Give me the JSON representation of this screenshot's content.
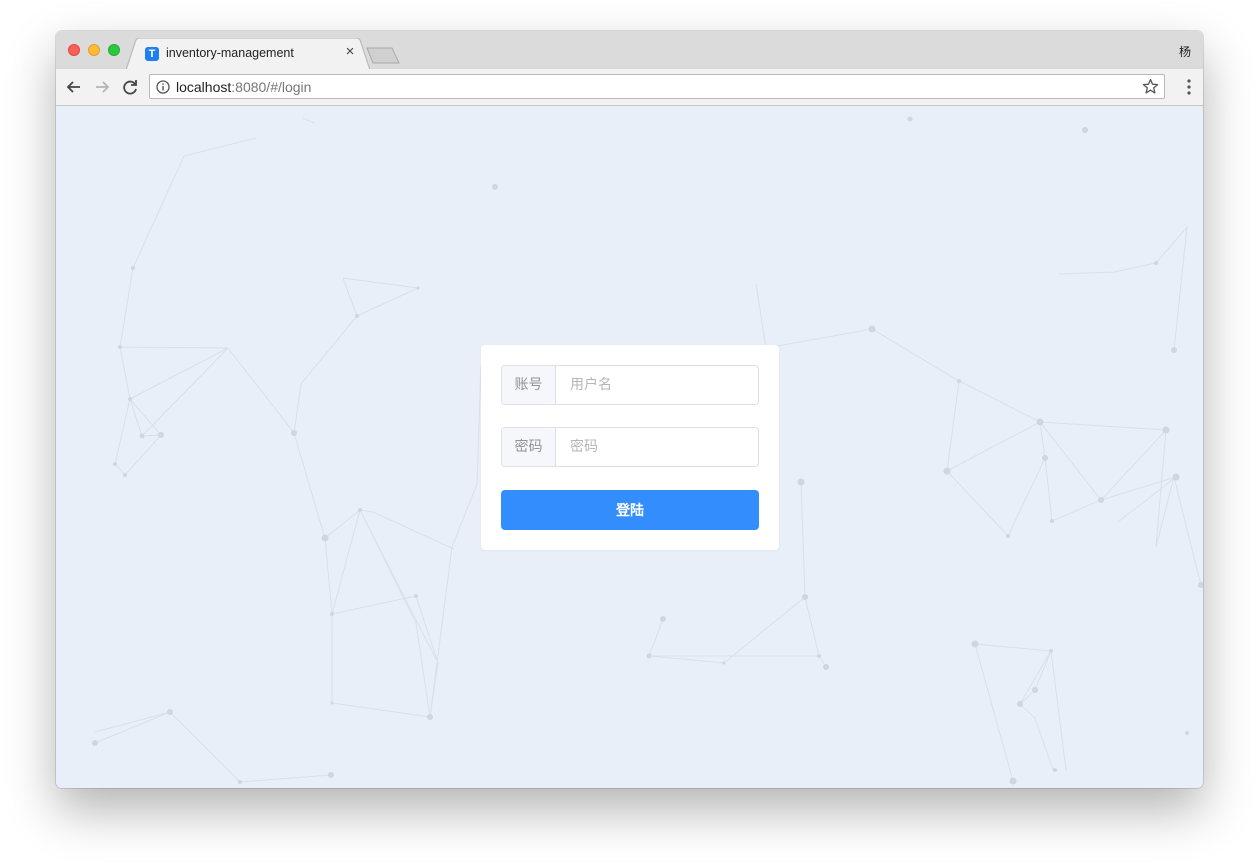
{
  "browser": {
    "tab": {
      "favicon_letter": "T",
      "title": "inventory-management",
      "close_glyph": "×"
    },
    "profile_name": "杨",
    "address_bar": {
      "host": "localhost",
      "rest": ":8080/#/login"
    },
    "icons": [
      "back-icon",
      "forward-icon",
      "reload-icon",
      "info-icon",
      "star-icon",
      "menu-icon"
    ]
  },
  "login": {
    "account_label": "账号",
    "account_placeholder": "用户名",
    "password_label": "密码",
    "password_placeholder": "密码",
    "submit_label": "登陆"
  },
  "colors": {
    "page_background": "#e9eff8",
    "primary_button": "#338dfd",
    "favicon": "#1e80f0"
  }
}
